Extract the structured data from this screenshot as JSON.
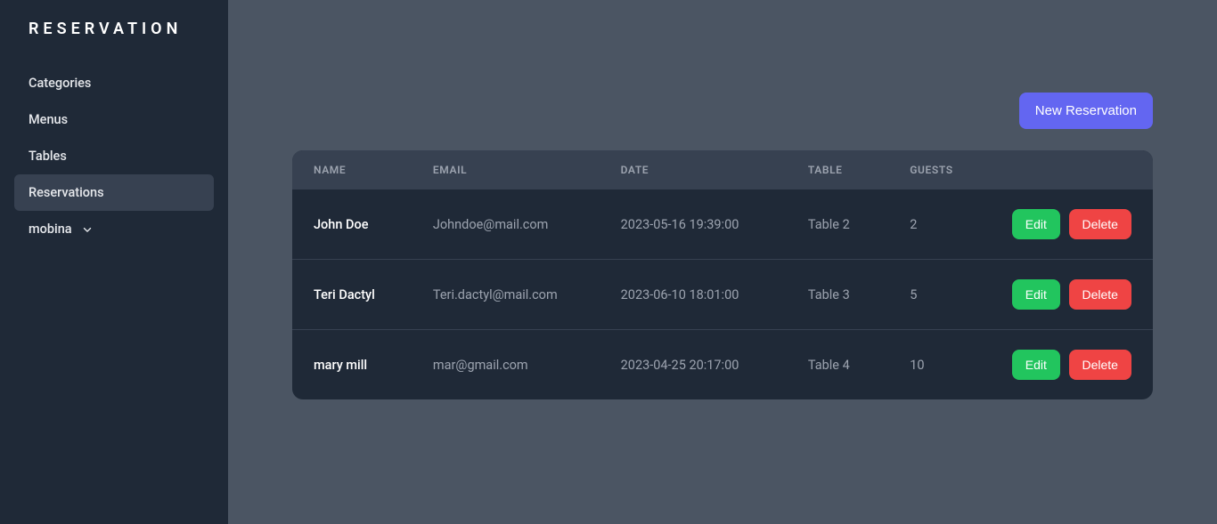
{
  "sidebar": {
    "title": "RESERVATION",
    "items": [
      {
        "label": "Categories",
        "active": false
      },
      {
        "label": "Menus",
        "active": false
      },
      {
        "label": "Tables",
        "active": false
      },
      {
        "label": "Reservations",
        "active": true
      }
    ],
    "user": {
      "label": "mobina"
    }
  },
  "actions": {
    "new_reservation": "New Reservation",
    "edit": "Edit",
    "delete": "Delete"
  },
  "table": {
    "columns": {
      "name": "NAME",
      "email": "EMAIL",
      "date": "DATE",
      "table": "TABLE",
      "guests": "GUESTS"
    },
    "rows": [
      {
        "name": "John Doe",
        "email": "Johndoe@mail.com",
        "date": "2023-05-16 19:39:00",
        "table": "Table 2",
        "guests": "2"
      },
      {
        "name": "Teri Dactyl",
        "email": "Teri.dactyl@mail.com",
        "date": "2023-06-10 18:01:00",
        "table": "Table 3",
        "guests": "5"
      },
      {
        "name": "mary mill",
        "email": "mar@gmail.com",
        "date": "2023-04-25 20:17:00",
        "table": "Table 4",
        "guests": "10"
      }
    ]
  }
}
